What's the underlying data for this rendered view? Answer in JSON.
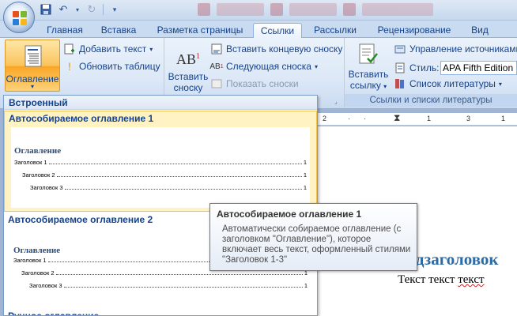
{
  "tabs": [
    "Главная",
    "Вставка",
    "Разметка страницы",
    "Ссылки",
    "Рассылки",
    "Рецензирование",
    "Вид"
  ],
  "active_tab": "Ссылки",
  "ribbon": {
    "toc": {
      "toc_button": "Оглавление",
      "add_text": "Добавить текст",
      "update_table": "Обновить таблицу"
    },
    "footnotes": {
      "insert_footnote_line1": "Вставить",
      "insert_footnote_line2": "сноску",
      "insert_endnote": "Вставить концевую сноску",
      "next_footnote": "Следующая сноска",
      "show_notes": "Показать сноски"
    },
    "citations": {
      "insert_citation_line1": "Вставить",
      "insert_citation_line2": "ссылку",
      "manage_sources": "Управление источниками",
      "style_label": "Стиль:",
      "style_value": "APA Fifth Edition",
      "bibliography": "Список литературы",
      "group_label": "Ссылки и списки литературы"
    }
  },
  "gallery": {
    "header": "Встроенный",
    "items": [
      {
        "title": "Автособираемое оглавление 1",
        "toc_heading": "Оглавление",
        "lines": [
          "Заголовок 1",
          "Заголовок 2",
          "Заголовок 3"
        ],
        "page": "1"
      },
      {
        "title": "Автособираемое оглавление 2",
        "toc_heading": "Оглавление",
        "lines": [
          "Заголовок 1",
          "Заголовок 2",
          "Заголовок 3"
        ],
        "page": "1"
      },
      {
        "title": "Ручное оглавление"
      }
    ]
  },
  "tooltip": {
    "title": "Автособираемое оглавление 1",
    "body": "Автоматически собираемое оглавление (с заголовком \"Оглавление\"), которое включает весь текст, оформленный стилями \"Заголовок 1-3\""
  },
  "document": {
    "subheading": "одзаголовок",
    "body_text_1": "Текст текст ",
    "body_text_2": "текст"
  },
  "colors": {
    "accent": "#15428b",
    "selected_bg": "#fff3c3",
    "toc_button_bg": "#fbc35b"
  }
}
